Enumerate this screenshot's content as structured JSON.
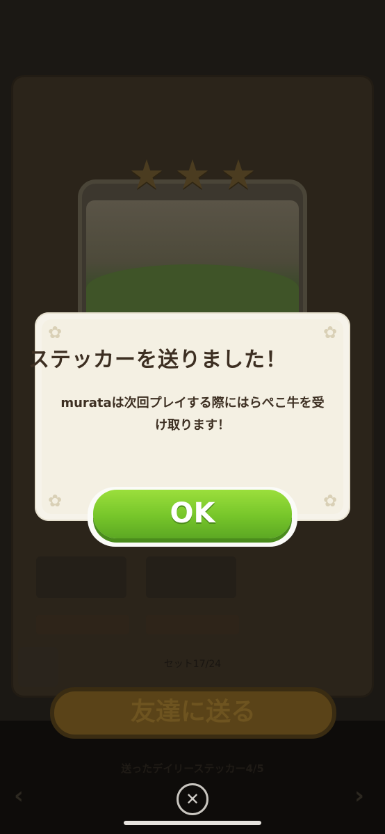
{
  "background": {
    "card_subtitle": "ステッカーを送りました",
    "tiles": [
      "",
      ""
    ],
    "set_progress": "セット17/24",
    "send_button_label": "友達に送る",
    "daily_sent_label": "送ったデイリーステッカー4/5",
    "nav_prev": "‹",
    "nav_next": "›",
    "close_glyph": "✕",
    "star_glyph": "★",
    "stars_count": 3
  },
  "modal": {
    "title": "ステッカーを送りました！",
    "message": "murataは次回プレイする際にはらぺこ牛を受け取ります！",
    "ok_label": "OK",
    "corner_glyph": "✿",
    "ok_color": "#76c52a",
    "panel_color": "#f6f3ea"
  }
}
